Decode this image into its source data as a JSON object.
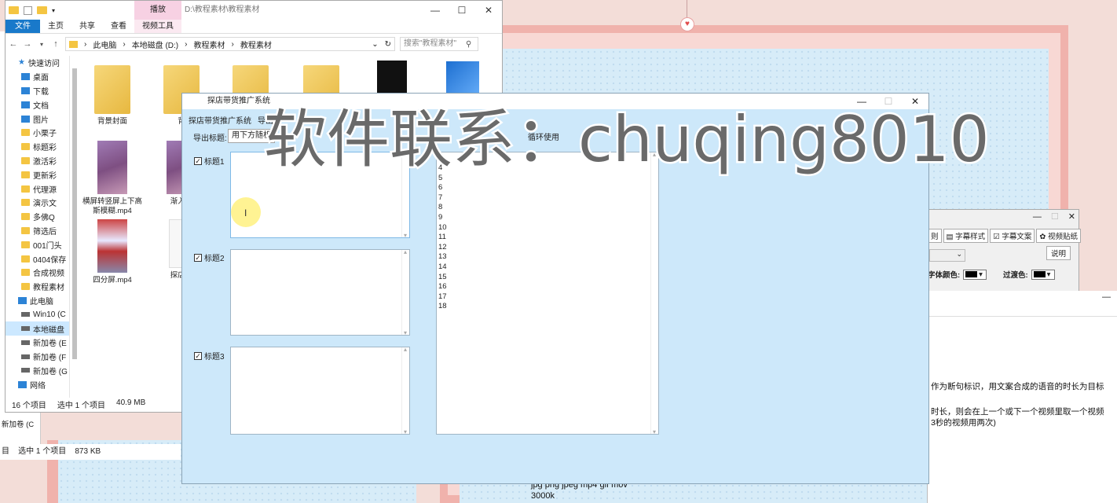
{
  "explorer": {
    "title_tabs_context": "播放",
    "title_path": "D:\\教程素材\\教程素材",
    "ribbon_tabs": [
      "文件",
      "主页",
      "共享",
      "查看",
      "视频工具"
    ],
    "address": {
      "crumbs": [
        "此电脑",
        "本地磁盘 (D:)",
        "教程素材",
        "教程素材"
      ],
      "search_placeholder": "搜索\"教程素材\""
    },
    "nav_items": [
      {
        "label": "快速访问",
        "icon": "star-icon",
        "top": true
      },
      {
        "label": "桌面",
        "icon": "desktop-icon"
      },
      {
        "label": "下载",
        "icon": "download-icon"
      },
      {
        "label": "文档",
        "icon": "document-icon"
      },
      {
        "label": "图片",
        "icon": "picture-icon"
      },
      {
        "label": "小栗子",
        "icon": "folder-icon"
      },
      {
        "label": "标题彩",
        "icon": "folder-icon"
      },
      {
        "label": "激活彩",
        "icon": "folder-icon"
      },
      {
        "label": "更新彩",
        "icon": "folder-icon"
      },
      {
        "label": "代理源",
        "icon": "folder-icon"
      },
      {
        "label": "演示文",
        "icon": "folder-icon"
      },
      {
        "label": "多佛Q",
        "icon": "folder-icon"
      },
      {
        "label": "筛选后",
        "icon": "folder-icon"
      },
      {
        "label": "001门头",
        "icon": "folder-icon"
      },
      {
        "label": "0404保存",
        "icon": "folder-icon"
      },
      {
        "label": "合成视频",
        "icon": "folder-icon"
      },
      {
        "label": "教程素材",
        "icon": "folder-icon"
      },
      {
        "label": "此电脑",
        "icon": "computer-icon",
        "top": true
      },
      {
        "label": "Win10 (C",
        "icon": "drive-icon"
      },
      {
        "label": "本地磁盘",
        "icon": "drive-icon",
        "selected": true
      },
      {
        "label": "新加卷 (E",
        "icon": "drive-icon"
      },
      {
        "label": "新加卷 (F",
        "icon": "drive-icon"
      },
      {
        "label": "新加卷 (G",
        "icon": "drive-icon"
      },
      {
        "label": "网络",
        "icon": "network-icon",
        "top": true
      }
    ],
    "files": [
      {
        "label": "背景封面",
        "kind": "folder"
      },
      {
        "label": "背",
        "kind": "folder"
      },
      {
        "label": "",
        "kind": "folder"
      },
      {
        "label": "",
        "kind": "folder"
      },
      {
        "label": "",
        "kind": "black"
      },
      {
        "label": "",
        "kind": "book"
      },
      {
        "label": "横屏转竖屏上下高斯模糊.mp4",
        "kind": "video"
      },
      {
        "label": "渐入渐",
        "kind": "video"
      },
      {
        "label": "四分屏.mp4",
        "kind": "video2"
      },
      {
        "label": "探店带",
        "kind": "doc"
      }
    ],
    "status_count": "16 个项目",
    "status_selected": "选中 1 个项目",
    "status_size": "40.9 MB"
  },
  "explorer2": {
    "status_left": "目",
    "status_selected": "选中 1 个项目",
    "status_size": "873 KB",
    "nav_item": "新加卷 (C"
  },
  "app": {
    "title": "探店带货推广系统",
    "menu": [
      "探店带货推广系统",
      "导出"
    ],
    "export_label": "导出标题:",
    "export_value": "用下方随机",
    "loop_label": "循环使用",
    "titles": [
      {
        "label": "标题1",
        "checked": true
      },
      {
        "label": "标题2",
        "checked": true
      },
      {
        "label": "标题3",
        "checked": true
      }
    ],
    "line_numbers": [
      "4",
      "5",
      "6",
      "7",
      "8",
      "9",
      "10",
      "11",
      "12",
      "13",
      "14",
      "15",
      "16",
      "17",
      "18"
    ]
  },
  "subpanel": {
    "tabs": [
      "则",
      "字幕样式",
      "字幕文案",
      "视频贴纸"
    ],
    "help": "说明",
    "font_color_label": "字体颜色:",
    "transition_label": "过渡色:",
    "font_color": "#000000",
    "transition_color": "#000000"
  },
  "doc": {
    "line1": "作为断句标识，用文案合成的语音的时长为目标",
    "line2": "时长，则会在上一个或下一个视频里取一个视频",
    "line3": "3秒的视频用两次)"
  },
  "bottom_text": {
    "formats": "jpg png jpeg mp4 gif mov",
    "bitrate": "3000k"
  },
  "watermark": "软件联系：chuqing8010"
}
